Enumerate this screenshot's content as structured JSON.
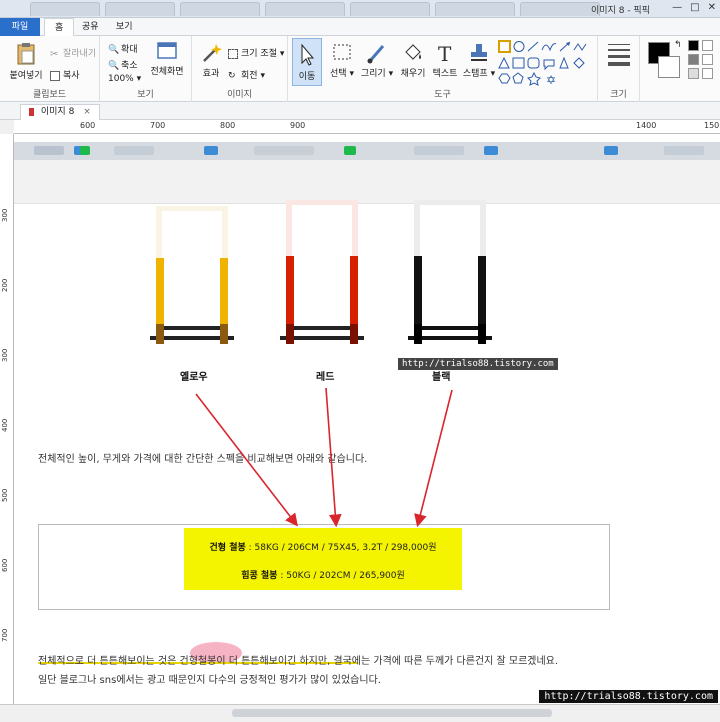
{
  "window": {
    "title": "이미지 8 - 픽픽",
    "controls": [
      "—",
      "□",
      "✕"
    ]
  },
  "menu": {
    "file": "파일",
    "home": "홈",
    "share": "공유",
    "view": "보기"
  },
  "ribbon": {
    "clipboard": {
      "paste": "붙여넣기",
      "cut": "잘라내기",
      "copy": "복사",
      "label": "클립보드"
    },
    "view": {
      "zoom_in": "확대",
      "zoom_out": "축소",
      "zoom_level": "100%",
      "fullscreen": "전체화면",
      "label": "보기"
    },
    "image": {
      "effect": "효과",
      "resize": "크기 조절",
      "rotate": "회전",
      "label": "이미지"
    },
    "tools": {
      "move": "이동",
      "select": "선택",
      "draw": "그리기",
      "fill": "채우기",
      "text": "텍스트",
      "stamp": "스탬프",
      "label": "도구"
    },
    "size": {
      "label": "크기"
    }
  },
  "document_tab": {
    "label": "이미지 8",
    "close": "×"
  },
  "ruler": {
    "h": [
      "600",
      "700",
      "800",
      "900",
      "1400",
      "150"
    ],
    "v": [
      "300",
      "200",
      "300",
      "400",
      "500",
      "600",
      "700"
    ]
  },
  "content": {
    "racks": [
      {
        "label": "옐로우",
        "color": "#f0b400"
      },
      {
        "label": "레드",
        "color": "#d62000"
      },
      {
        "label": "블랙",
        "color": "#111111"
      }
    ],
    "watermark_top": "http://trialso88.tistory.com",
    "intro": "전체적인 높이, 무게와 가격에 대한 간단한 스펙을 비교해보면 아래와 같습니다.",
    "spec1_name": "건형 철봉",
    "spec1_value": " : 58KG / 206CM / 75X45, 3.2T / 298,000원",
    "spec2_name": "힘콩 철봉",
    "spec2_value": " : 50KG / 202CM / 265,900원",
    "conclusion1": "전체적으로 더 튼튼해보이는 것은 건형철봉이 더 튼튼해보이긴 하지만, 결국에는 가격에 따른 두께가 다른건지 잘 모르겠네요.",
    "conclusion2": "일단 블로그나 sns에서는 광고 때문인지 다수의 긍정적인 평가가 많이 있었습니다.",
    "watermark_bottom": "http://trialso88.tistory.com"
  },
  "colors": {
    "accent": "#2a6fc9",
    "highlight_yellow": "#f4f400",
    "arrow": "#d8262d"
  }
}
